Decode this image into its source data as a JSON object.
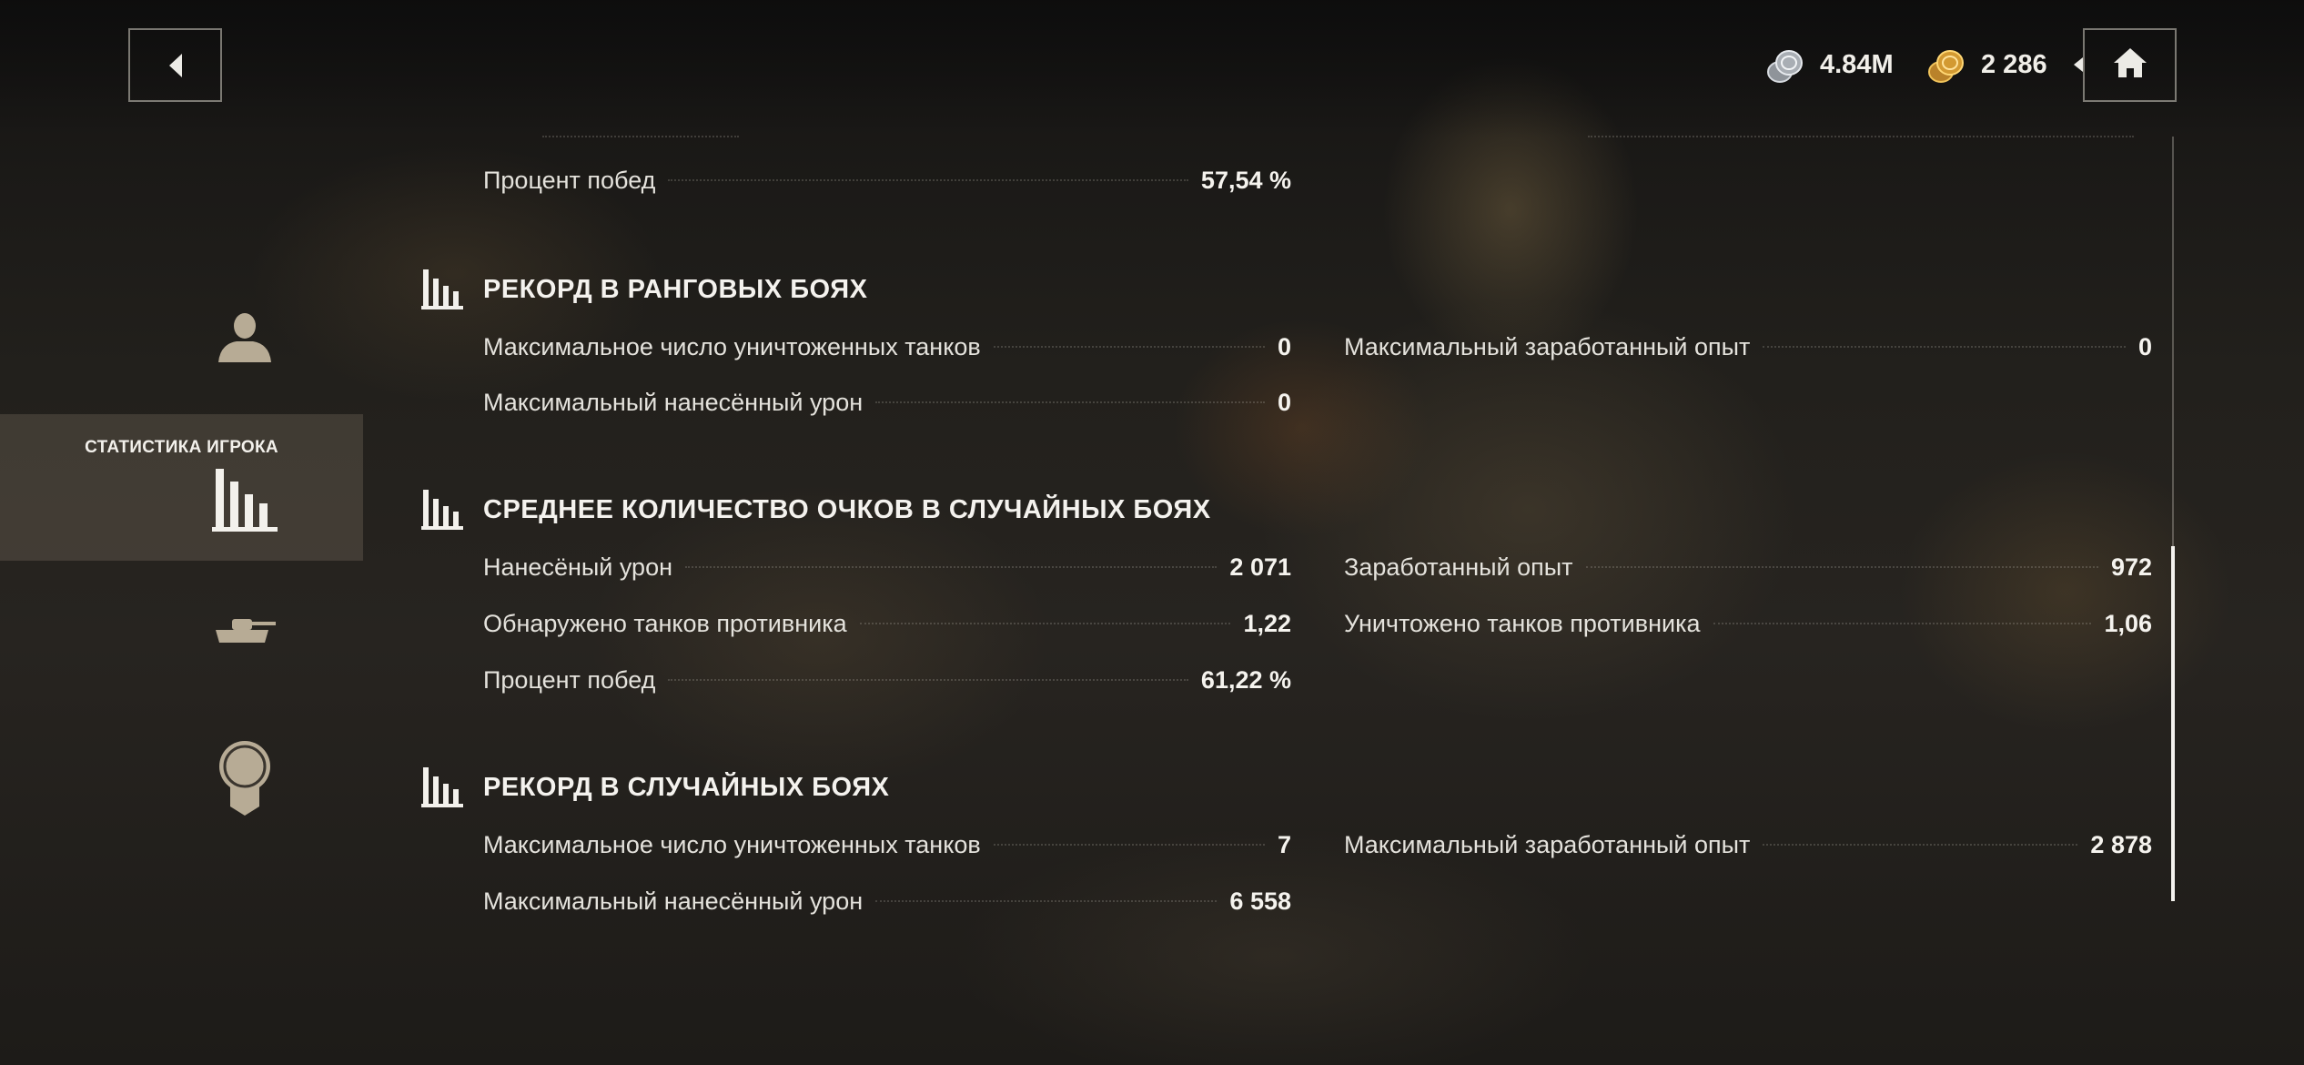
{
  "header": {
    "silver": "4.84M",
    "gold": "2 286",
    "icons": {
      "back": "back-arrow-icon",
      "home": "home-icon",
      "silver": "silver-coins-icon",
      "gold": "gold-coins-icon"
    }
  },
  "sidebar": {
    "items": [
      {
        "id": "profile",
        "icon": "person-icon",
        "label": ""
      },
      {
        "id": "stats",
        "icon": "bar-chart-icon",
        "label": "СТАТИСТИКА ИГРОКА",
        "active": true
      },
      {
        "id": "tanks",
        "icon": "tank-icon",
        "label": ""
      },
      {
        "id": "achievements",
        "icon": "medal-icon",
        "label": ""
      }
    ]
  },
  "sections": {
    "top": {
      "win_rate_label": "Процент побед",
      "win_rate_value": "57,54 %"
    },
    "ranked_record": {
      "title": "РЕКОРД В РАНГОВЫХ БОЯХ",
      "rows": [
        {
          "label": "Максимальное число уничтоженных танков",
          "value": "0"
        },
        {
          "label": "Максимальный заработанный опыт",
          "value": "0"
        },
        {
          "label": "Максимальный нанесённый урон",
          "value": "0"
        }
      ]
    },
    "random_average": {
      "title": "СРЕДНЕЕ КОЛИЧЕСТВО ОЧКОВ В СЛУЧАЙНЫХ БОЯХ",
      "rows": [
        {
          "label": "Нанесёный урон",
          "value": "2 071"
        },
        {
          "label": "Заработанный опыт",
          "value": "972"
        },
        {
          "label": "Обнаружено танков противника",
          "value": "1,22"
        },
        {
          "label": "Уничтожено танков противника",
          "value": "1,06"
        },
        {
          "label": "Процент побед",
          "value": "61,22 %"
        }
      ]
    },
    "random_record": {
      "title": "РЕКОРД В СЛУЧАЙНЫХ БОЯХ",
      "rows": [
        {
          "label": "Максимальное число уничтоженных танков",
          "value": "7"
        },
        {
          "label": "Максимальный заработанный опыт",
          "value": "2 878"
        },
        {
          "label": "Максимальный нанесённый урон",
          "value": "6 558"
        }
      ]
    }
  },
  "colors": {
    "text": "#ecebe6",
    "accent_panel": "#5a5348",
    "icon_muted": "#b8ad98"
  }
}
